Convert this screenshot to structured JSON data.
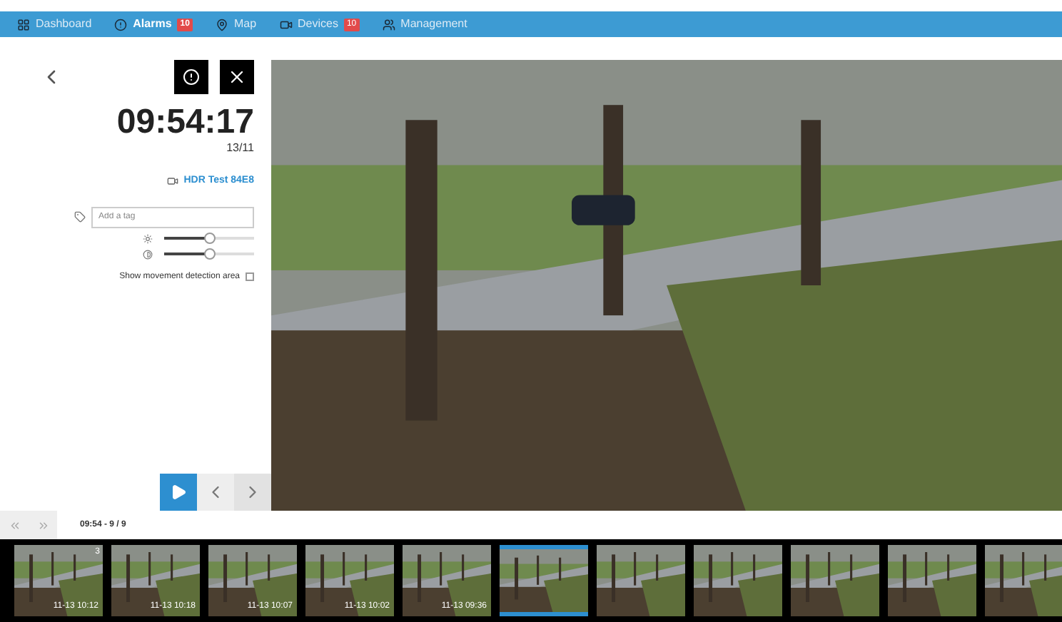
{
  "nav": [
    {
      "label": "Dashboard",
      "kind": "grid",
      "selected": false
    },
    {
      "label": "Alarms",
      "kind": "alert",
      "badge": "10",
      "selected": true
    },
    {
      "label": "Map",
      "kind": "pin",
      "selected": false
    },
    {
      "label": "Devices",
      "kind": "camera",
      "badge": "10",
      "selected": false
    },
    {
      "label": "Management",
      "kind": "users",
      "selected": false
    }
  ],
  "panel": {
    "time": "09:54:17",
    "date": "13/11",
    "device": "HDR Test 84E8",
    "tag_placeholder": "Add a tag",
    "sliders": [
      {
        "kind": "brightness",
        "level": 0.5
      },
      {
        "kind": "contrast",
        "level": 0.5
      }
    ],
    "movement": {
      "label": "Show movement detection area",
      "checked": false
    }
  },
  "counter": "09:54 - 9 / 9",
  "thumbnails": [
    {
      "time": "11-13 10:12",
      "badge": "3",
      "selected": false
    },
    {
      "time": "11-13 10:18",
      "selected": false
    },
    {
      "time": "11-13 10:07",
      "selected": false
    },
    {
      "time": "11-13 10:02",
      "selected": false
    },
    {
      "time": "11-13 09:36",
      "selected": false
    },
    {
      "selected": true
    },
    {
      "selected": false
    },
    {
      "selected": false
    },
    {
      "selected": false
    },
    {
      "selected": false
    },
    {
      "selected": false
    }
  ]
}
